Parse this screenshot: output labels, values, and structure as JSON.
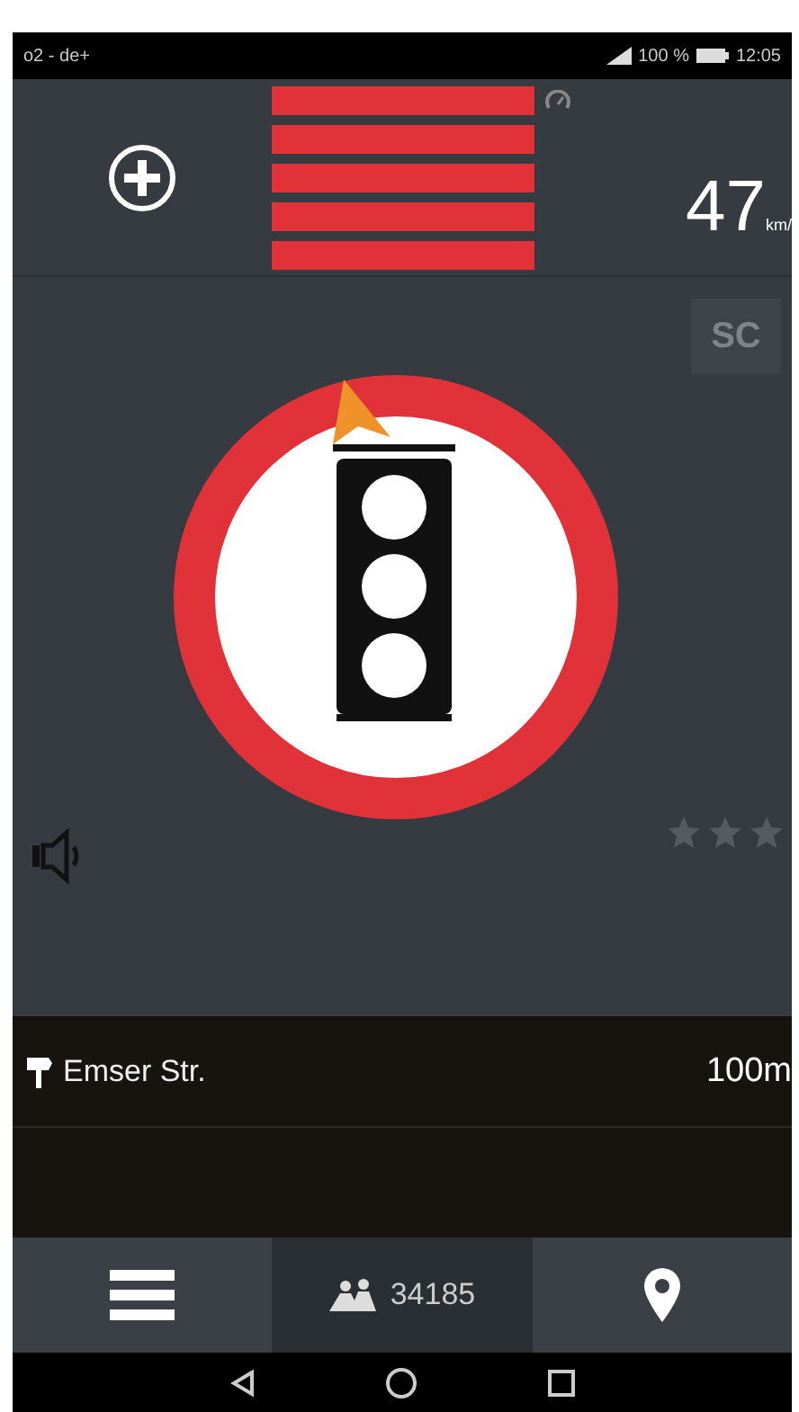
{
  "status_bar": {
    "carrier": "o2 - de+",
    "battery": "100 %",
    "time": "12:05"
  },
  "speed": {
    "value": "47",
    "unit": "km/"
  },
  "sc_button": "SC",
  "rating": {
    "stars": 0
  },
  "street": {
    "name": "Emser Str.",
    "distance": "100m"
  },
  "bottom_nav": [
    {
      "kind": "menu",
      "selected": false
    },
    {
      "kind": "count",
      "label": "34185",
      "selected": true
    },
    {
      "kind": "location",
      "selected": false
    }
  ]
}
